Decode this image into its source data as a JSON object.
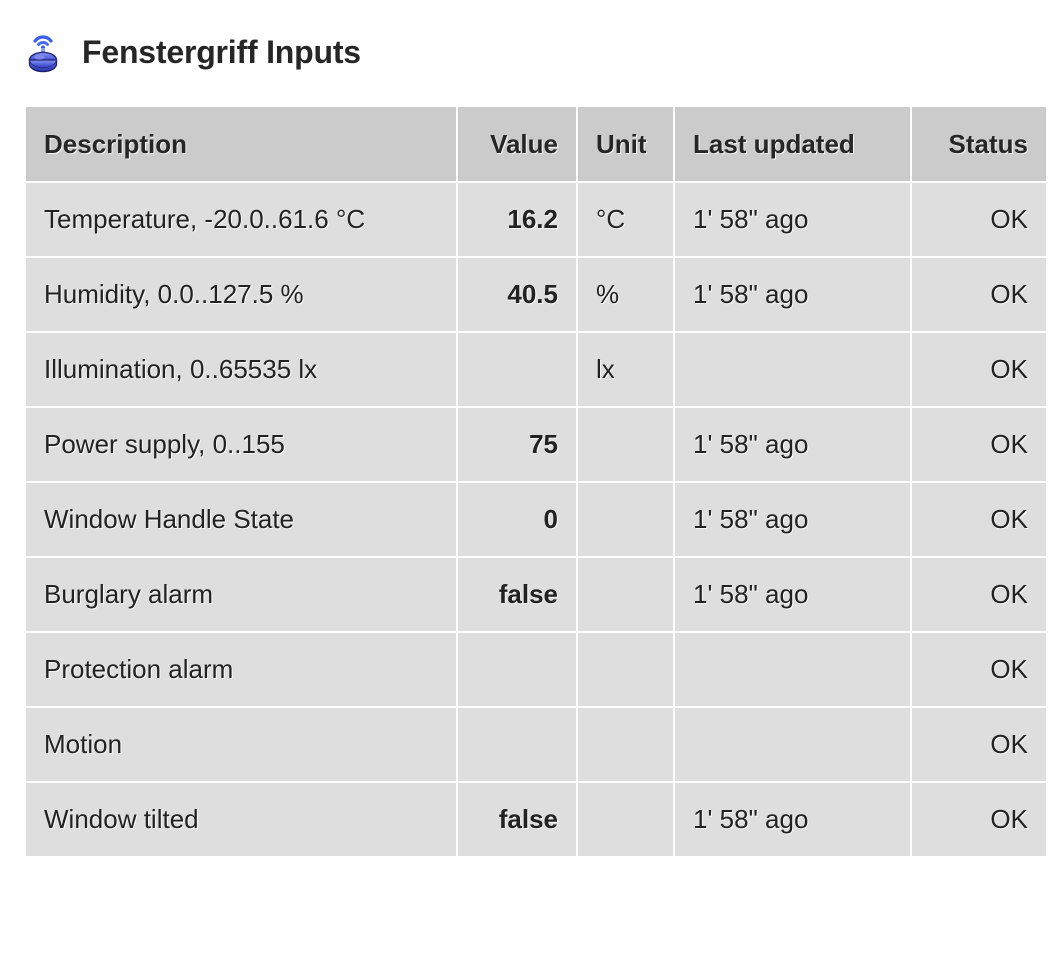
{
  "header": {
    "title": "Fenstergriff Inputs",
    "icon": "wireless-sensor-icon"
  },
  "table": {
    "columns": [
      {
        "key": "description",
        "label": "Description",
        "align": "left"
      },
      {
        "key": "value",
        "label": "Value",
        "align": "right"
      },
      {
        "key": "unit",
        "label": "Unit",
        "align": "left"
      },
      {
        "key": "last_updated",
        "label": "Last updated",
        "align": "left"
      },
      {
        "key": "status",
        "label": "Status",
        "align": "right"
      }
    ],
    "rows": [
      {
        "description": "Temperature, -20.0..61.6 °C",
        "value": "16.2",
        "unit": "°C",
        "last_updated": "1' 58\" ago",
        "status": "OK"
      },
      {
        "description": "Humidity, 0.0..127.5 %",
        "value": "40.5",
        "unit": "%",
        "last_updated": "1' 58\" ago",
        "status": "OK"
      },
      {
        "description": "Illumination, 0..65535 lx",
        "value": "",
        "unit": "lx",
        "last_updated": "",
        "status": "OK"
      },
      {
        "description": "Power supply, 0..155",
        "value": "75",
        "unit": "",
        "last_updated": "1' 58\" ago",
        "status": "OK"
      },
      {
        "description": "Window Handle State",
        "value": "0",
        "unit": "",
        "last_updated": "1' 58\" ago",
        "status": "OK"
      },
      {
        "description": "Burglary alarm",
        "value": "false",
        "unit": "",
        "last_updated": "1' 58\" ago",
        "status": "OK"
      },
      {
        "description": "Protection alarm",
        "value": "",
        "unit": "",
        "last_updated": "",
        "status": "OK"
      },
      {
        "description": "Motion",
        "value": "",
        "unit": "",
        "last_updated": "",
        "status": "OK"
      },
      {
        "description": "Window tilted",
        "value": "false",
        "unit": "",
        "last_updated": "1' 58\" ago",
        "status": "OK"
      }
    ]
  },
  "colors": {
    "page_background": "#ffffff",
    "header_cell": "#cbcbcb",
    "body_cell": "#dedede",
    "text": "#222222",
    "icon_blue": "#3b4fd8"
  }
}
